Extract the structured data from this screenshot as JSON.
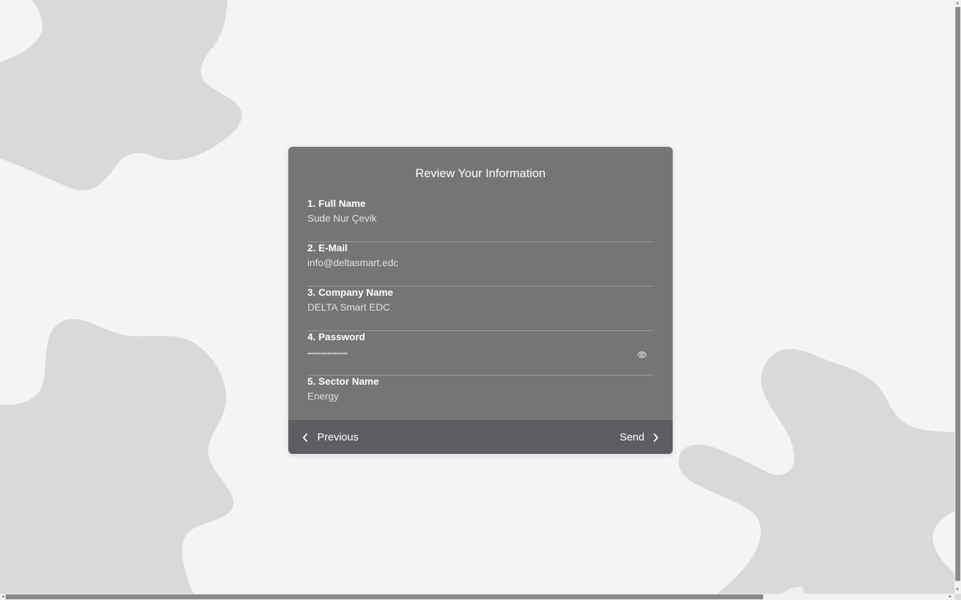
{
  "theme": {
    "background": "#f3f4f6",
    "blob": "#d9d9d9",
    "card": "#757575",
    "footer": "#5d5e62",
    "text": "#ffffff",
    "value_text": "#e1e1e1"
  },
  "card": {
    "title": "Review Your Information",
    "fields": [
      {
        "label": "1. Full Name",
        "value": "Sude Nur Çevik"
      },
      {
        "label": "2. E-Mail",
        "value": "info@deltasmart.edc"
      },
      {
        "label": "3. Company Name",
        "value": "DELTA Smart EDC"
      },
      {
        "label": "4. Password",
        "value": "••••••••••••••••••",
        "icon": "eye-icon"
      },
      {
        "label": "5. Sector Name",
        "value": "Energy"
      }
    ]
  },
  "footer": {
    "previous_label": "Previous",
    "send_label": "Send",
    "previous_icon": "chevron-left-icon",
    "send_icon": "chevron-right-icon"
  }
}
